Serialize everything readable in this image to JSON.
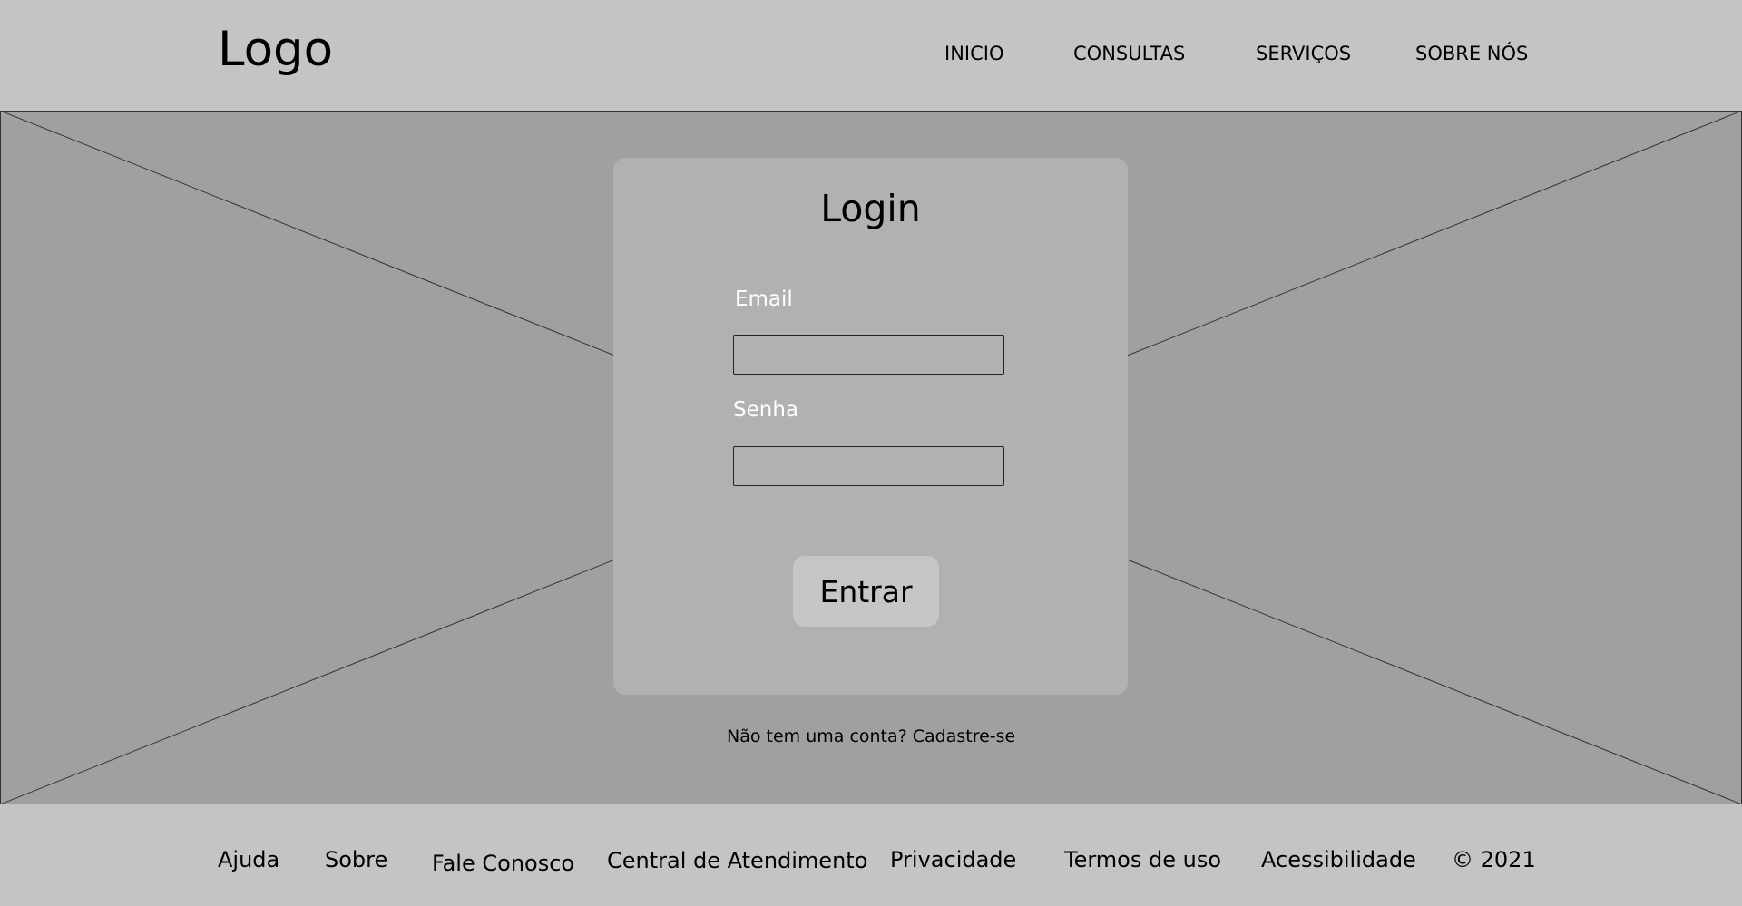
{
  "header": {
    "logo": "Logo",
    "nav": [
      "INICIO",
      "CONSULTAS",
      "SERVIÇOS",
      "SOBRE NÓS"
    ]
  },
  "login": {
    "title": "Login",
    "email_label": "Email",
    "email_value": "",
    "password_label": "Senha",
    "password_value": "",
    "submit_label": "Entrar"
  },
  "signup": {
    "prompt": "Não tem uma conta?",
    "link": "Cadastre-se"
  },
  "footer": {
    "links": [
      "Ajuda",
      "Sobre",
      "Fale Conosco",
      "Central de Atendimento",
      "Privacidade",
      "Termos de uso",
      "Acessibilidade"
    ],
    "copyright": "© 2021"
  },
  "colors": {
    "header_bg": "#c4c4c4",
    "hero_bg": "#a0a0a0",
    "card_bg": "#b1b1b1",
    "button_bg": "#c6c6c6",
    "label_text": "#ffffff"
  }
}
